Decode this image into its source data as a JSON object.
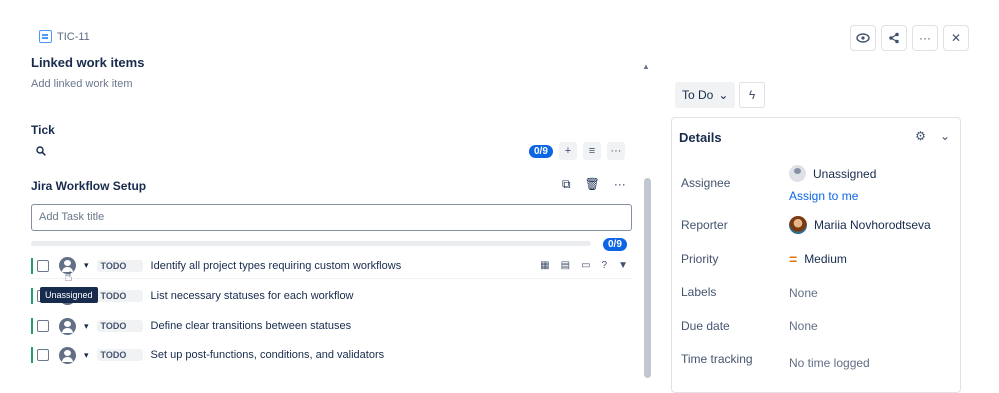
{
  "header": {
    "issue_key": "TIC-11",
    "actions": [
      {
        "icon": "eye-icon",
        "glyph": "◉"
      },
      {
        "icon": "share-icon",
        "glyph": "<"
      },
      {
        "icon": "more-icon",
        "glyph": "···"
      },
      {
        "icon": "close-icon",
        "glyph": "✕"
      }
    ]
  },
  "linked": {
    "title": "Linked work items",
    "add_label": "Add linked work item"
  },
  "tick": {
    "title": "Tick",
    "badge": "0/9"
  },
  "workflow": {
    "title": "Jira Workflow Setup",
    "add_placeholder": "Add Task title",
    "progress_badge": "0/9",
    "progress_fraction": 0.0,
    "tasks": [
      {
        "status": "TODO",
        "text": "Identify all project types requiring custom workflows"
      },
      {
        "status": "TODO",
        "text": "List necessary statuses for each workflow"
      },
      {
        "status": "TODO",
        "text": "Define clear transitions between statuses"
      },
      {
        "status": "TODO",
        "text": "Set up post-functions, conditions, and validators"
      }
    ],
    "tooltip": "Unassigned"
  },
  "status": {
    "label": "To Do"
  },
  "details": {
    "title": "Details",
    "fields": [
      {
        "label": "Assignee",
        "value": "Unassigned",
        "link": "Assign to me"
      },
      {
        "label": "Reporter",
        "value": "Mariia Novhorodtseva"
      },
      {
        "label": "Priority",
        "value": "Medium"
      },
      {
        "label": "Labels",
        "value": "None"
      },
      {
        "label": "Due date",
        "value": "None"
      },
      {
        "label": "Time tracking",
        "value": "No time logged"
      }
    ]
  },
  "colors": {
    "accent": "#0c66e4",
    "todo_bar": "#22a06b",
    "priority_medium": "#e2740a"
  }
}
